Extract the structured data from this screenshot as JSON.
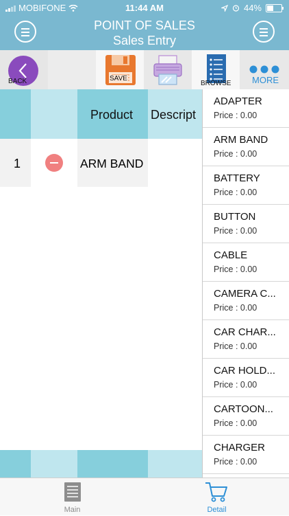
{
  "status": {
    "carrier": "MOBIFONE",
    "time": "11:44 AM",
    "battery": "44%"
  },
  "header": {
    "title": "POINT OF SALES",
    "subtitle": "Sales Entry"
  },
  "toolbar": {
    "back_label": "BACK",
    "save_label": "SAVE",
    "browse_label": "BROWSE",
    "more_label": "MORE"
  },
  "table": {
    "columns": [
      "",
      "",
      "Product",
      "Descript"
    ],
    "rows": [
      {
        "no": "1",
        "product": "ARM BAND"
      }
    ]
  },
  "products": [
    {
      "name": "ADAPTER",
      "price": "Price : 0.00"
    },
    {
      "name": "ARM BAND",
      "price": "Price : 0.00"
    },
    {
      "name": "BATTERY",
      "price": "Price : 0.00"
    },
    {
      "name": "BUTTON",
      "price": "Price : 0.00"
    },
    {
      "name": "CABLE",
      "price": "Price : 0.00"
    },
    {
      "name": "CAMERA C...",
      "price": "Price : 0.00"
    },
    {
      "name": "CAR CHAR...",
      "price": "Price : 0.00"
    },
    {
      "name": "CAR HOLD...",
      "price": "Price : 0.00"
    },
    {
      "name": "CARTOON...",
      "price": "Price : 0.00"
    },
    {
      "name": "CHARGER",
      "price": "Price : 0.00"
    }
  ],
  "tabs": [
    {
      "label": "Main"
    },
    {
      "label": "Detail"
    }
  ],
  "colors": {
    "header": "#7ab8d0",
    "accent": "#2d8fd6",
    "back": "#8a4bbd",
    "save": "#e8782f",
    "remove": "#f08080"
  }
}
